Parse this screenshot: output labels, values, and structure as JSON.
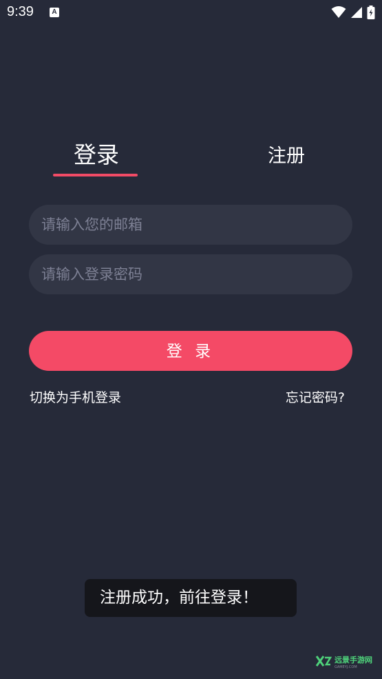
{
  "status_bar": {
    "time": "9:39",
    "notification_icon": "A"
  },
  "tabs": {
    "login": "登录",
    "register": "注册"
  },
  "form": {
    "email_placeholder": "请输入您的邮箱",
    "password_placeholder": "请输入登录密码",
    "login_button": "登 录",
    "switch_to_phone": "切换为手机登录",
    "forgot_password": "忘记密码?"
  },
  "toast": {
    "message": "注册成功，前往登录！"
  },
  "watermark": {
    "brand": "远景手游网",
    "domain": "GAMEYJ.COM"
  },
  "colors": {
    "background": "#262a39",
    "accent": "#f44a66",
    "input_bg": "#323645"
  }
}
